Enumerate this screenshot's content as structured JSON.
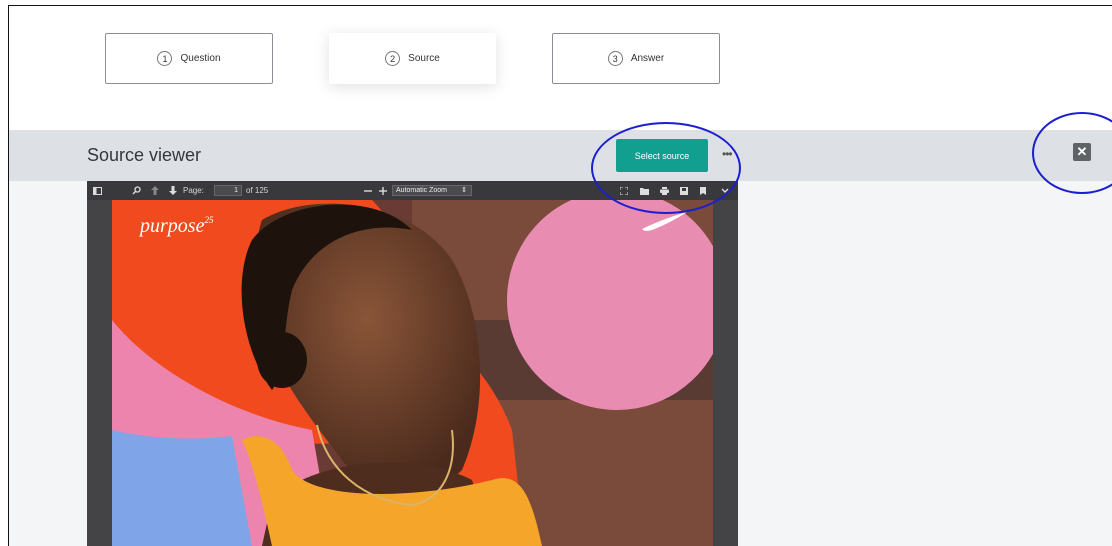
{
  "steps": [
    {
      "num": "1",
      "label": "Question"
    },
    {
      "num": "2",
      "label": "Source"
    },
    {
      "num": "3",
      "label": "Answer"
    }
  ],
  "viewer": {
    "title": "Source viewer",
    "select_source_label": "Select source",
    "more_label": "•••",
    "close_label": "✕"
  },
  "pdf": {
    "page_label": "Page:",
    "page_value": "1",
    "page_total": "of 125",
    "zoom_value": "Automatic Zoom",
    "cover_brand": "purpose",
    "cover_brand_sup": "25"
  },
  "colors": {
    "accent": "#119f8f",
    "annotation": "#1b1fd0",
    "viewer_bar": "#dde0e4"
  }
}
